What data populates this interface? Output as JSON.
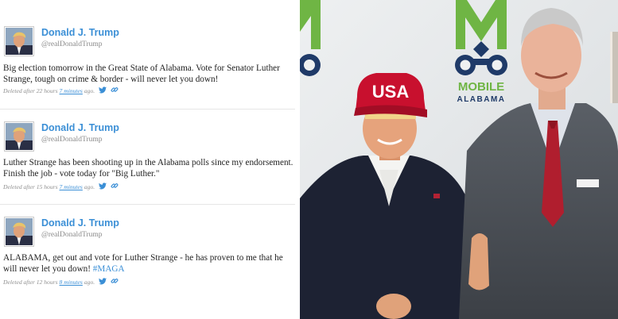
{
  "tweets": [
    {
      "name": "Donald J. Trump",
      "handle": "@realDonaldTrump",
      "text": "Big election tomorrow in the Great State of Alabama. Vote for Senator Luther Strange, tough on crime & border - will never let you down!",
      "meta_prefix": "Deleted after 22 hours",
      "meta_minutes": "7 minutes",
      "meta_suffix": "ago."
    },
    {
      "name": "Donald J. Trump",
      "handle": "@realDonaldTrump",
      "text": "Luther Strange has been shooting up in the Alabama polls since my endorsement. Finish the job - vote today for \"Big Luther.\"",
      "meta_prefix": "Deleted after 15 hours",
      "meta_minutes": "7 minutes",
      "meta_suffix": "ago."
    },
    {
      "name": "Donald J. Trump",
      "handle": "@realDonaldTrump",
      "text_main": "ALABAMA, get out and vote for Luther Strange - he has proven to me that he will never let you down! ",
      "hashtag": "#MAGA",
      "meta_prefix": "Deleted after 12 hours",
      "meta_minutes": "8 minutes",
      "meta_suffix": "ago."
    }
  ],
  "photo": {
    "hat_text": "USA",
    "banner_word": "MOBILE",
    "banner_sub": "ALABAMA"
  },
  "icons": [
    "twitter-bird-icon",
    "link-icon"
  ],
  "colors": {
    "link_blue": "#3b8fd6",
    "logo_green": "#6fb544",
    "logo_navy": "#1f3a68",
    "hat_red": "#c8102e"
  }
}
